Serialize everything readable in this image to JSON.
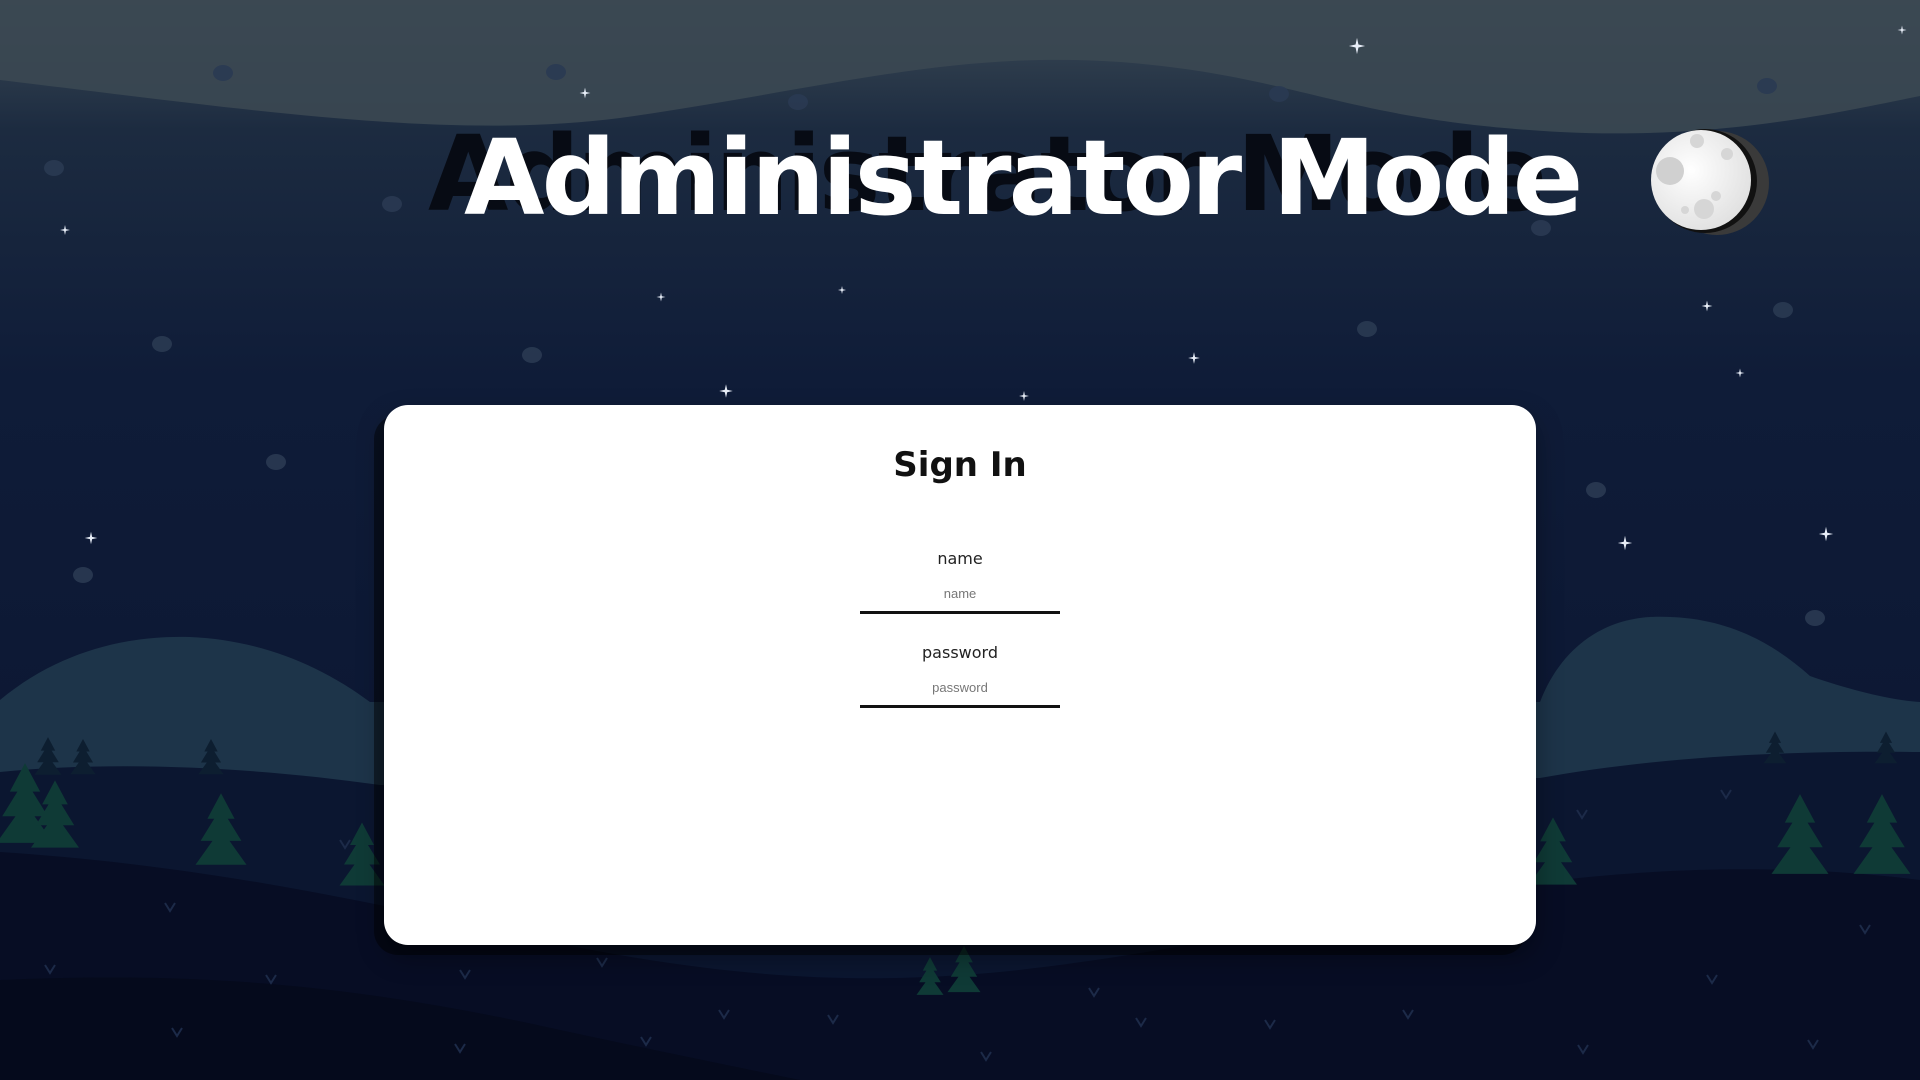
{
  "page": {
    "title": "Administrator Mode"
  },
  "theme": {
    "sky_top": "#3c4a55",
    "sky_bottom": "#0d1a36",
    "hill_far": "#1d3449",
    "hill_mid": "#0b1630",
    "hill_near": "#070d24",
    "tree_color": "#0f3a36",
    "moon_color": "#f2f2f2",
    "card_background": "#ffffff"
  },
  "signin": {
    "title": "Sign In",
    "name_label": "name",
    "name_placeholder": "name",
    "name_value": "",
    "password_label": "password",
    "password_placeholder": "password",
    "password_value": ""
  },
  "icons": {
    "moon": "moon-icon",
    "star": "star-icon",
    "tree": "pine-tree-icon"
  }
}
